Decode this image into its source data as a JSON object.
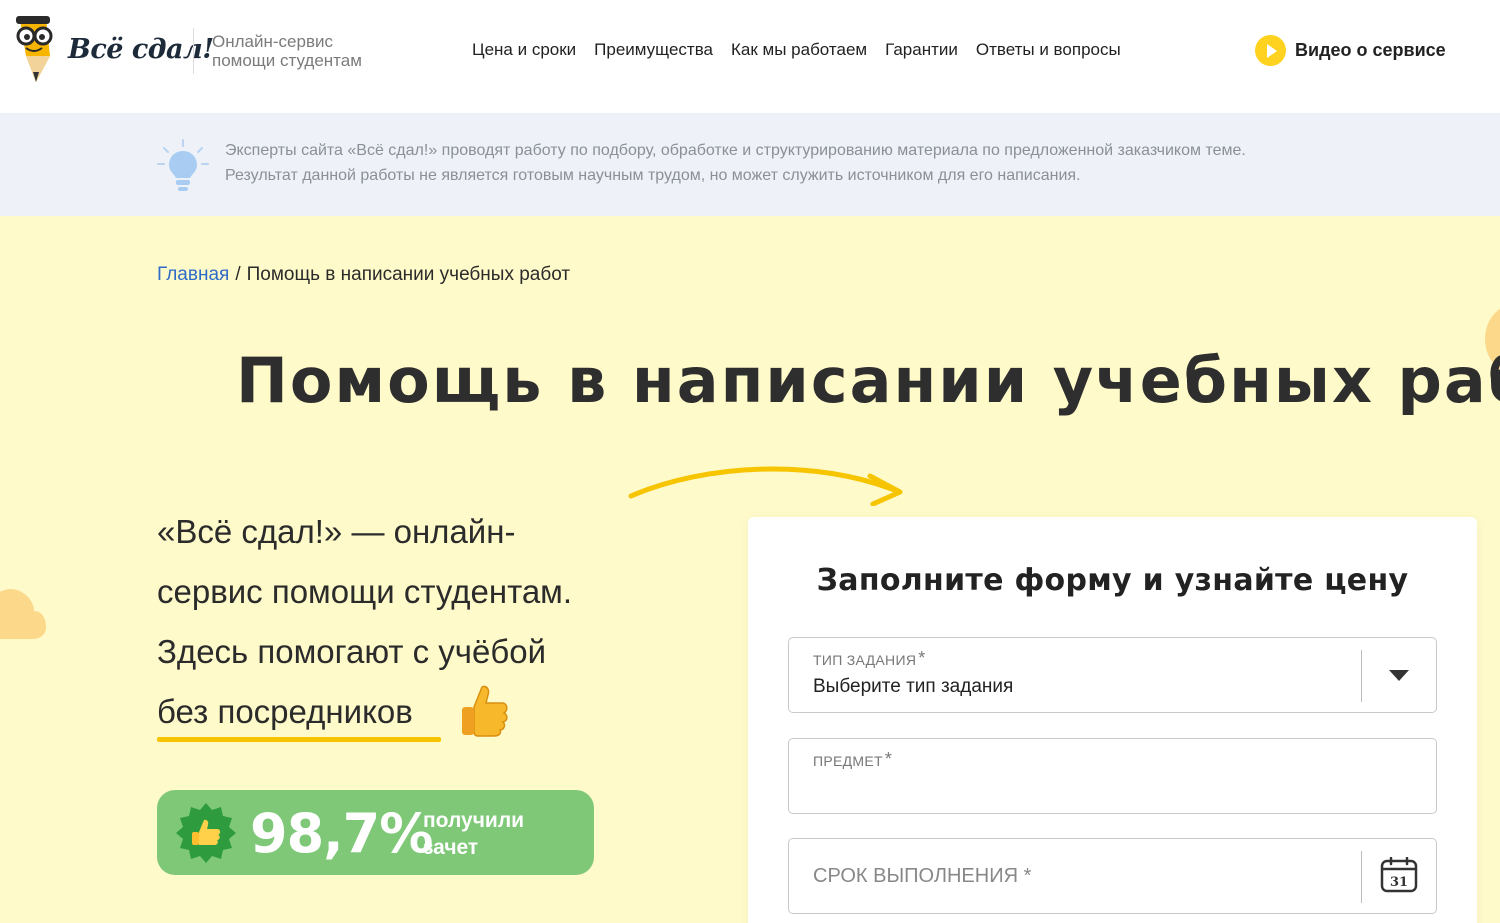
{
  "header": {
    "logo_text": "Всё сдал!",
    "tagline_line1": "Онлайн-сервис",
    "tagline_line2": "помощи студентам",
    "nav": [
      {
        "label": "Цена и сроки"
      },
      {
        "label": "Преимущества"
      },
      {
        "label": "Как мы работаем"
      },
      {
        "label": "Гарантии"
      },
      {
        "label": "Ответы и вопросы"
      }
    ],
    "video_label": "Видео о сервисе"
  },
  "notice": {
    "line1": "Эксперты сайта «Всё сдал!» проводят работу по подбору, обработке и структурированию материала по предложенной заказчиком теме.",
    "line2": "Результат данной работы не является готовым научным трудом, но может служить источником для его написания."
  },
  "breadcrumb": {
    "home": "Главная",
    "separator": "/",
    "current": "Помощь в написании учебных работ"
  },
  "hero": {
    "title": "Помощь в написании учебных работ",
    "lead_line1": "«Всё сдал!» — онлайн-",
    "lead_line2": "сервис помощи студентам.",
    "lead_line3": "Здесь помогают с учёбой",
    "lead_line4": "без посредников",
    "stat_value": "98,7%",
    "stat_caption_line1": "получили",
    "stat_caption_line2": "зачет"
  },
  "form": {
    "title": "Заполните форму и узнайте цену",
    "task_type": {
      "label": "Тип задания",
      "required": "*",
      "value": "Выберите тип задания"
    },
    "subject": {
      "label": "Предмет",
      "required": "*",
      "value": ""
    },
    "deadline": {
      "placeholder": "Срок выполнения *"
    },
    "calendar_day": "31"
  },
  "colors": {
    "accent_yellow": "#ffd21f",
    "hero_bg": "#fffac9",
    "notice_bg": "#eef2f8",
    "badge_green": "#7ec878",
    "link_blue": "#2f6cc7"
  },
  "icons": [
    "mascot-logo",
    "play-icon",
    "lightbulb-icon",
    "arrow-icon",
    "thumbs-up-icon",
    "seal-thumbs-up-icon",
    "chevron-down-icon",
    "calendar-icon"
  ]
}
